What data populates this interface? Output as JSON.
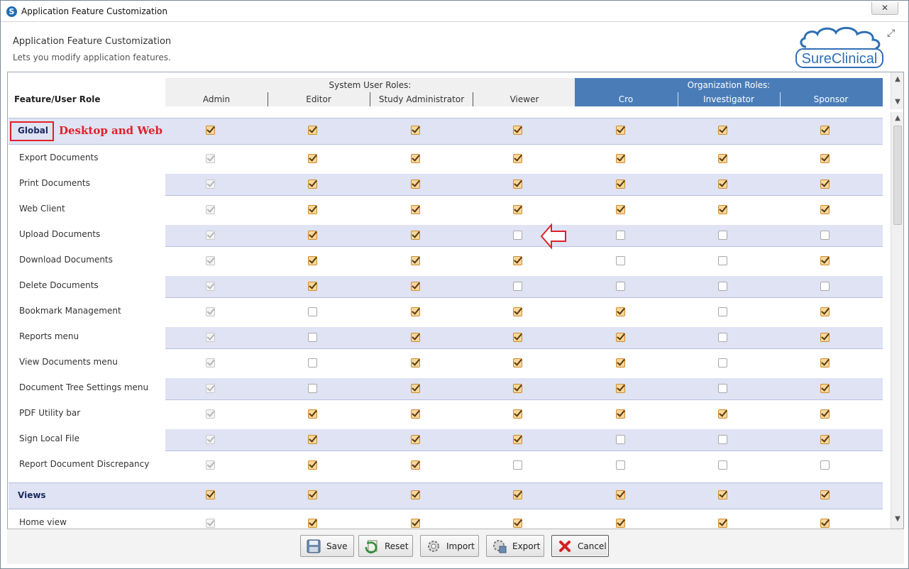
{
  "window": {
    "title": "Application Feature Customization",
    "close_label": "✕"
  },
  "header": {
    "title": "Application Feature Customization",
    "subtitle": "Lets you modify application features.",
    "logo_text": "SureClinical"
  },
  "columns": {
    "feature_header": "Feature/User Role",
    "system_group_title": "System User Roles:",
    "org_group_title": "Organization Roles:",
    "system_roles": [
      "Admin",
      "Editor",
      "Study Administrator",
      "Viewer"
    ],
    "org_roles": [
      "Cro",
      "Investigator",
      "Sponsor"
    ]
  },
  "annotation": {
    "desktop_web": "Desktop and Web"
  },
  "sections": [
    {
      "name": "Global",
      "checks": [
        1,
        1,
        1,
        1,
        1,
        1,
        1
      ],
      "features": [
        {
          "label": "Export Documents",
          "checks": [
            "d",
            1,
            1,
            1,
            1,
            1,
            1
          ]
        },
        {
          "label": "Print Documents",
          "checks": [
            "d",
            1,
            1,
            1,
            1,
            1,
            1
          ]
        },
        {
          "label": "Web Client",
          "checks": [
            "d",
            1,
            1,
            1,
            1,
            1,
            1
          ]
        },
        {
          "label": "Upload Documents",
          "checks": [
            "d",
            1,
            1,
            0,
            0,
            0,
            0
          ]
        },
        {
          "label": "Download Documents",
          "checks": [
            "d",
            1,
            1,
            1,
            0,
            0,
            1
          ]
        },
        {
          "label": "Delete Documents",
          "checks": [
            "d",
            1,
            1,
            0,
            0,
            0,
            0
          ]
        },
        {
          "label": "Bookmark Management",
          "checks": [
            "d",
            0,
            1,
            1,
            1,
            0,
            1
          ]
        },
        {
          "label": "Reports menu",
          "checks": [
            "d",
            0,
            1,
            1,
            1,
            0,
            1
          ]
        },
        {
          "label": "View Documents menu",
          "checks": [
            "d",
            0,
            1,
            1,
            1,
            0,
            1
          ]
        },
        {
          "label": "Document Tree Settings menu",
          "checks": [
            "d",
            0,
            1,
            1,
            1,
            0,
            1
          ]
        },
        {
          "label": "PDF Utility bar",
          "checks": [
            "d",
            1,
            1,
            1,
            1,
            1,
            1
          ]
        },
        {
          "label": "Sign Local File",
          "checks": [
            "d",
            1,
            1,
            1,
            0,
            0,
            1
          ]
        },
        {
          "label": "Report Document Discrepancy",
          "checks": [
            "d",
            1,
            1,
            0,
            0,
            0,
            0
          ]
        }
      ]
    },
    {
      "name": "Views",
      "checks": [
        1,
        1,
        1,
        1,
        1,
        1,
        1
      ],
      "features": [
        {
          "label": "Home view",
          "checks": [
            "d",
            1,
            1,
            1,
            1,
            1,
            1
          ]
        }
      ]
    }
  ],
  "footer": {
    "save": "Save",
    "reset": "Reset",
    "import": "Import",
    "export": "Export",
    "cancel": "Cancel"
  },
  "colors": {
    "org_header_bg": "#4a7db8",
    "band_bg": "#dfe3f4",
    "annotation_red": "#e0202a",
    "checked_fill": "#f7d79a"
  }
}
